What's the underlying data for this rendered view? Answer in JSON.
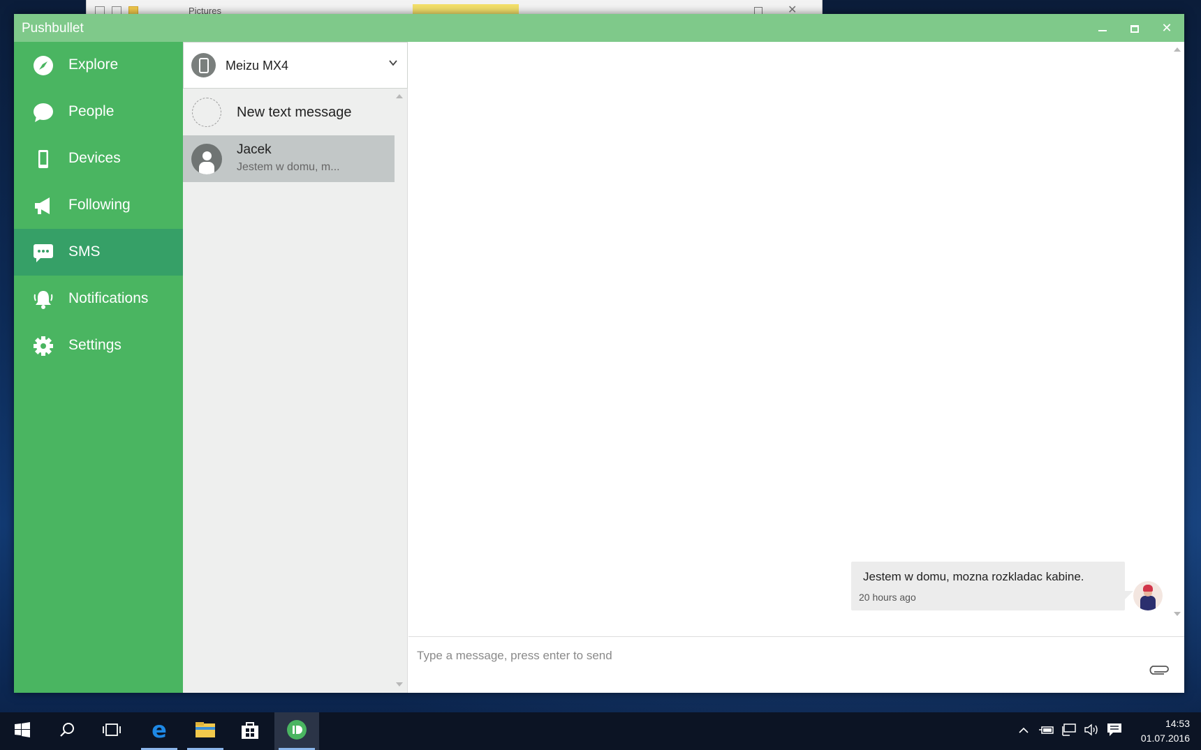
{
  "background_window": {
    "title": "Pictures"
  },
  "app": {
    "title": "Pushbullet",
    "colors": {
      "titlebar": "#7fc98a",
      "sidebar": "#4ab561",
      "sidebar_active": "#36a067"
    }
  },
  "sidebar": {
    "items": [
      {
        "label": "Explore",
        "icon": "compass-icon"
      },
      {
        "label": "People",
        "icon": "chat-bubble-icon"
      },
      {
        "label": "Devices",
        "icon": "phone-icon"
      },
      {
        "label": "Following",
        "icon": "megaphone-icon"
      },
      {
        "label": "SMS",
        "icon": "sms-icon",
        "active": true
      },
      {
        "label": "Notifications",
        "icon": "bell-icon"
      },
      {
        "label": "Settings",
        "icon": "gear-icon"
      }
    ]
  },
  "device_selector": {
    "selected": "Meizu MX4"
  },
  "conversations": {
    "new_label": "New text message",
    "items": [
      {
        "name": "Jacek",
        "preview": "Jestem w domu, m..."
      }
    ]
  },
  "chat": {
    "messages": [
      {
        "text": "Jestem w domu, mozna rozkladac kabine.",
        "time": "20 hours ago"
      }
    ],
    "composer_placeholder": "Type a message, press enter to send"
  },
  "taskbar": {
    "time": "14:53",
    "date": "01.07.2016"
  }
}
